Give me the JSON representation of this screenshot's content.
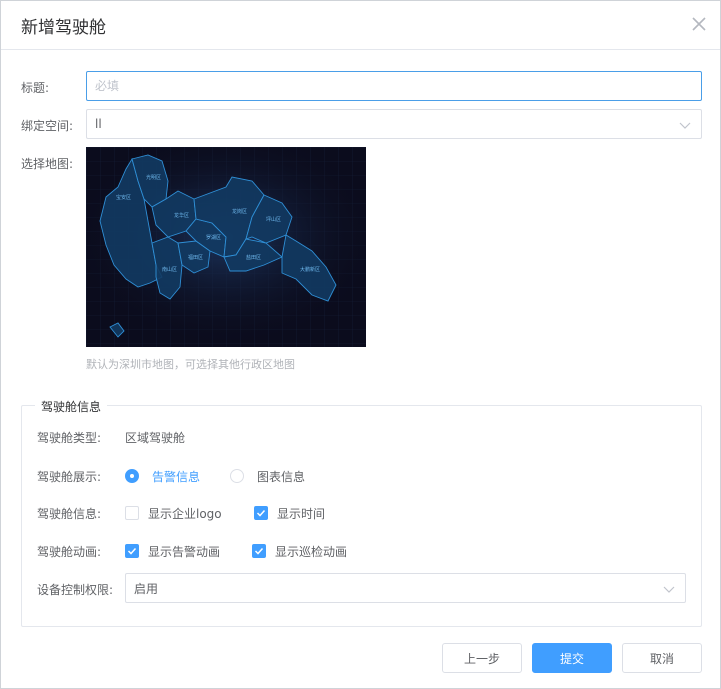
{
  "dialog": {
    "title": "新增驾驶舱"
  },
  "form": {
    "title_label": "标题:",
    "title_placeholder": "必填",
    "title_value": "",
    "space_label": "绑定空间:",
    "space_value": "ll",
    "map_label": "选择地图:",
    "map_hint": "默认为深圳市地图，可选择其他行政区地图",
    "map_districts": [
      "宝安区",
      "光明区",
      "龙华区",
      "南山区",
      "福田区",
      "罗湖区",
      "龙岗区",
      "坪山区",
      "盐田区",
      "大鹏新区"
    ]
  },
  "cockpit": {
    "legend": "驾驶舱信息",
    "type_label": "驾驶舱类型:",
    "type_value": "区域驾驶舱",
    "display_label": "驾驶舱展示:",
    "display_options": [
      {
        "label": "告警信息",
        "selected": true
      },
      {
        "label": "图表信息",
        "selected": false
      }
    ],
    "info_label": "驾驶舱信息:",
    "info_options": [
      {
        "label": "显示企业logo",
        "checked": false
      },
      {
        "label": "显示时间",
        "checked": true
      }
    ],
    "anim_label": "驾驶舱动画:",
    "anim_options": [
      {
        "label": "显示告警动画",
        "checked": true
      },
      {
        "label": "显示巡检动画",
        "checked": true
      }
    ],
    "control_label": "设备控制权限:",
    "control_value": "启用"
  },
  "buttons": {
    "prev": "上一步",
    "submit": "提交",
    "cancel": "取消"
  },
  "colors": {
    "primary": "#409eff",
    "map_bg": "#0b0c1d",
    "map_fill": "#143a63",
    "map_stroke": "#2f8fd6"
  }
}
